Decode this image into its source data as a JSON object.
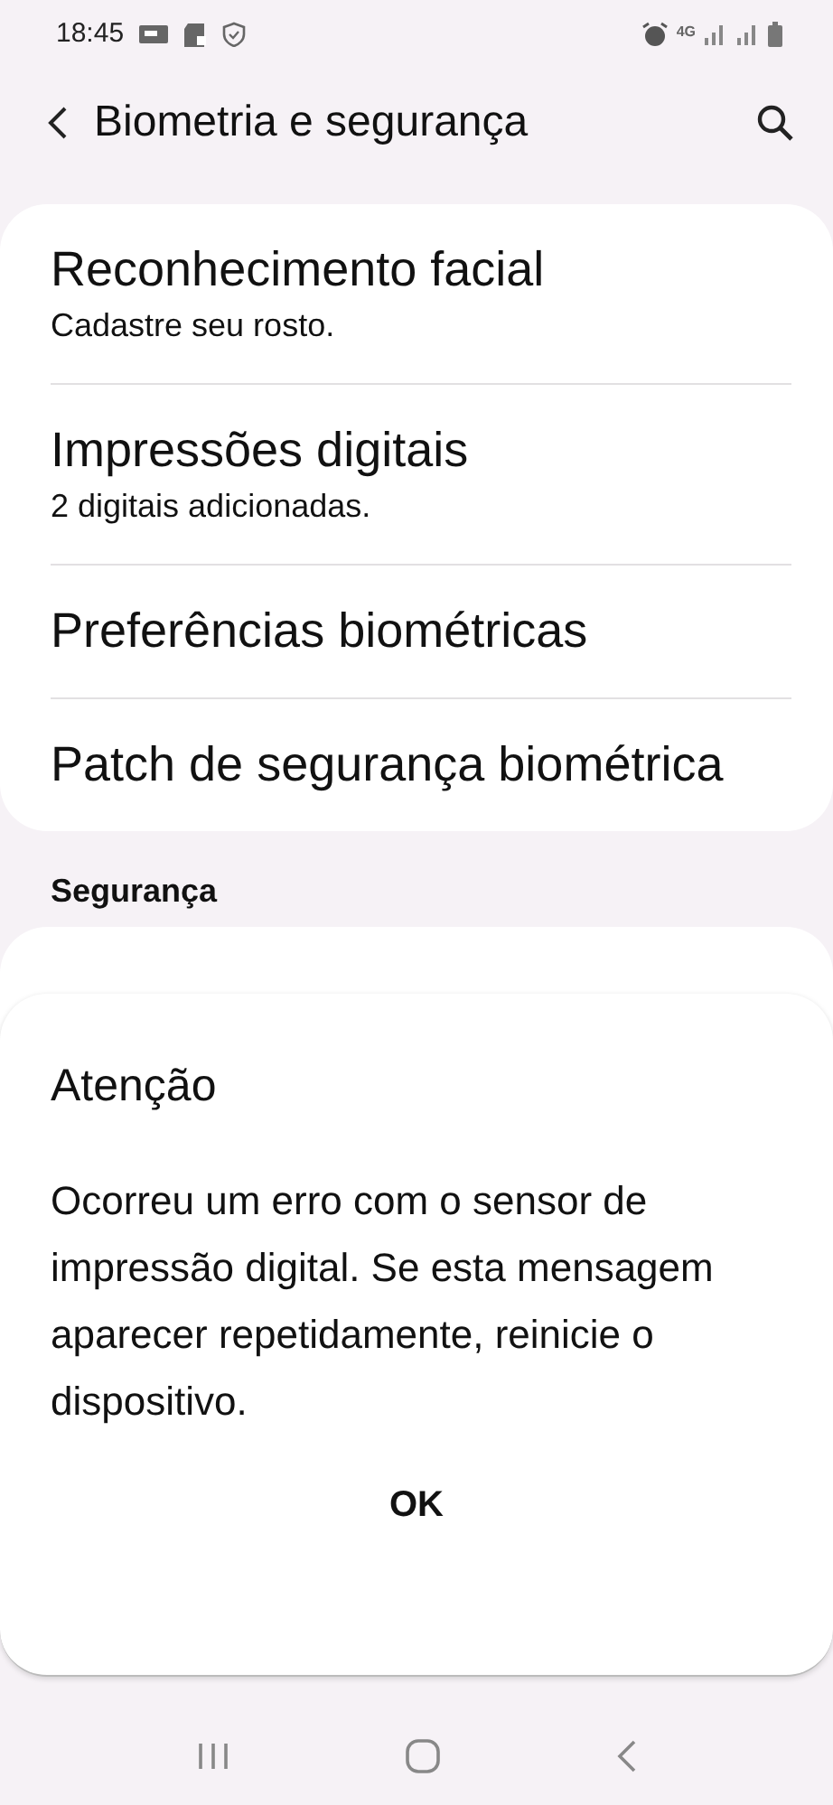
{
  "status_bar": {
    "time": "18:45",
    "network": "4G"
  },
  "app_bar": {
    "title": "Biometria e segurança"
  },
  "items": [
    {
      "title": "Reconhecimento facial",
      "subtitle": "Cadastre seu rosto."
    },
    {
      "title": "Impressões digitais",
      "subtitle": "2 digitais adicionadas."
    },
    {
      "title": "Preferências biométricas"
    },
    {
      "title": "Patch de segurança biométrica"
    }
  ],
  "section_header": "Segurança",
  "dialog": {
    "title": "Atenção",
    "message": "Ocorreu um erro com o sensor de impressão digital. Se esta mensagem aparecer repetidamente, reinicie o dispositivo.",
    "buttons": [
      "OK"
    ]
  }
}
